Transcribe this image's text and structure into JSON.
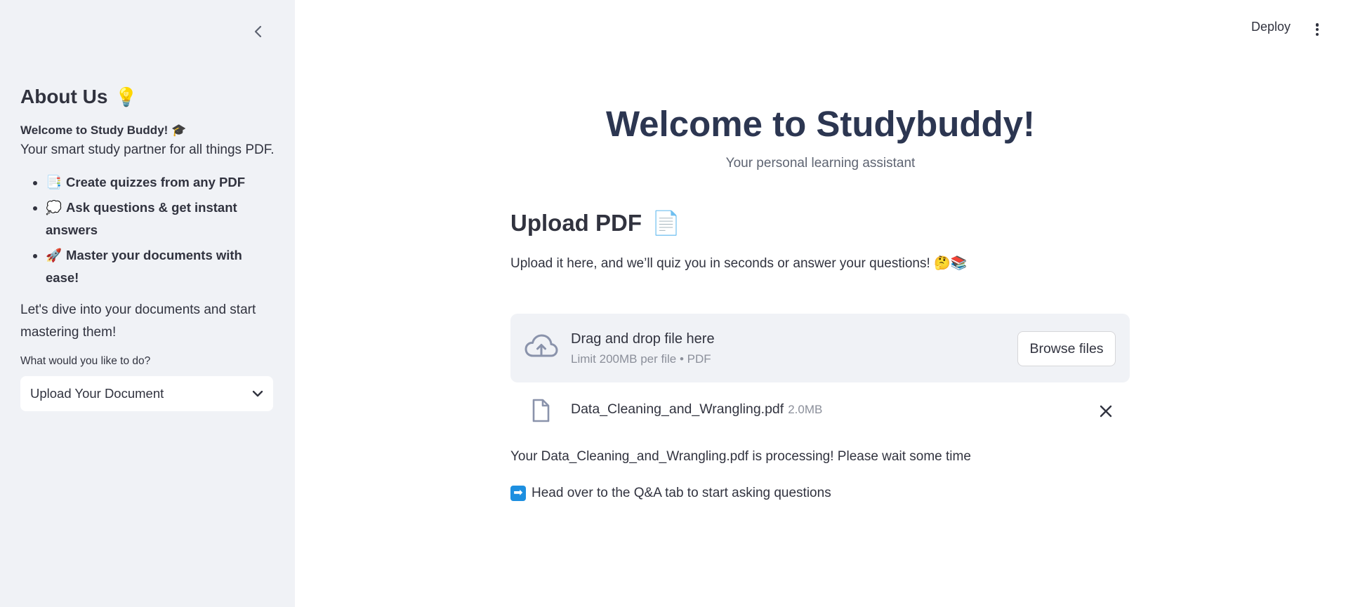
{
  "header": {
    "deploy_label": "Deploy"
  },
  "sidebar": {
    "title": "About Us",
    "title_emoji": "💡",
    "welcome": "Welcome to Study Buddy! 🎓",
    "subtitle": "Your smart study partner for all things PDF.",
    "features": [
      {
        "emoji": "📑",
        "text": "Create quizzes from any PDF"
      },
      {
        "emoji": "💭",
        "text": "Ask questions & get instant answers"
      },
      {
        "emoji": "🚀",
        "text": "Master your documents with ease!"
      }
    ],
    "dive_text": "Let's dive into your documents and start mastering them!",
    "select_label": "What would you like to do?",
    "select_value": "Upload Your Document"
  },
  "main": {
    "title": "Welcome to Studybuddy!",
    "subtitle": "Your personal learning assistant",
    "upload_heading": "Upload PDF",
    "upload_heading_emoji": "📄",
    "upload_description": "Upload it here, and we’ll quiz you in seconds or answer your questions! 🤔📚",
    "dropzone": {
      "main_text": "Drag and drop file here",
      "limit_text": "Limit 200MB per file • PDF",
      "browse_label": "Browse files"
    },
    "file": {
      "name": "Data_Cleaning_and_Wrangling.pdf",
      "size": "2.0MB"
    },
    "processing_message": "Your Data_Cleaning_and_Wrangling.pdf is processing! Please wait some time",
    "qa_arrow": "➡",
    "qa_message": "Head over to the Q&A tab to start asking questions"
  },
  "colors": {
    "sidebar_bg": "#f0f2f6",
    "title_color": "#2c3651",
    "text_color": "#31333f",
    "muted_text": "#8b8f9a"
  }
}
